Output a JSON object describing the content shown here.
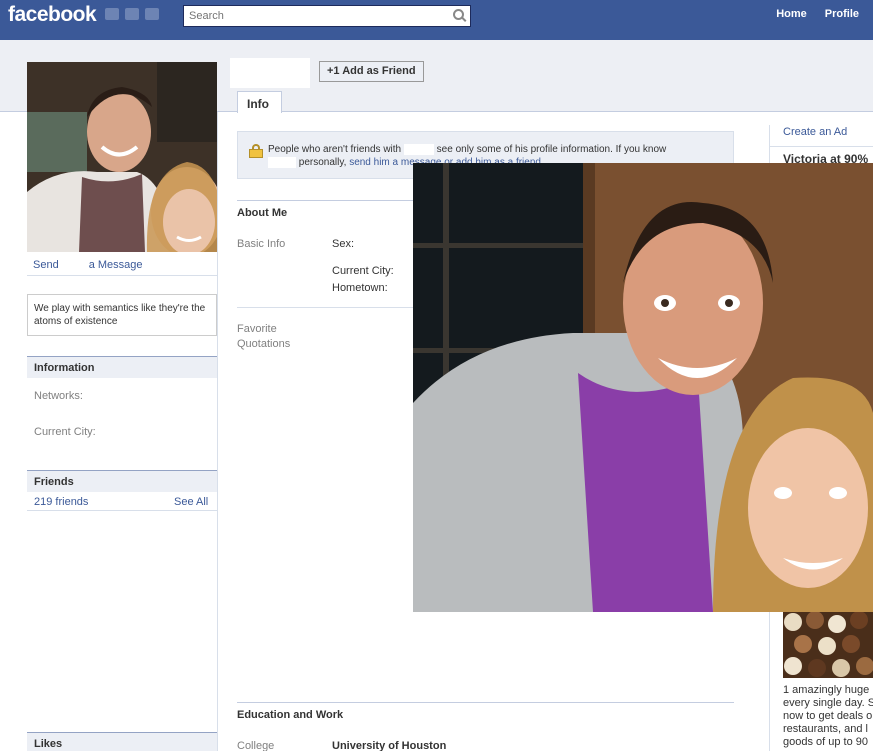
{
  "topbar": {
    "logo": "facebook",
    "search_placeholder": "Search",
    "links": [
      "Home",
      "Profile"
    ]
  },
  "header": {
    "add_friend_label": "+1 Add as Friend",
    "tab_label": "Info"
  },
  "left": {
    "send_message": [
      "Send",
      "a Message"
    ],
    "quote": "We play with semantics like they're the atoms of existence",
    "information": {
      "title": "Information",
      "networks_label": "Networks:",
      "city_label": "Current City:"
    },
    "friends": {
      "title": "Friends",
      "count": "219 friends",
      "see_all": "See All"
    },
    "likes_title": "Likes"
  },
  "main": {
    "notice": {
      "part1": "People who aren't friends with",
      "part2": "see only some of his profile information. If you know",
      "part3": "personally,",
      "link": "send him a message or add him as a friend."
    },
    "about_me": {
      "title": "About Me",
      "basic_info_label": "Basic Info",
      "sex_label": "Sex:",
      "current_city_label": "Current City:",
      "hometown_label": "Hometown:",
      "favorite_quotations_label": "Favorite Quotations"
    },
    "education": {
      "title": "Education and Work",
      "college_label": "College",
      "college_value": "University of Houston"
    }
  },
  "right": {
    "create_ad": "Create an Ad",
    "ad_title": "Victoria at 90%",
    "ad_text": [
      "1 amazingly huge",
      "every single day. S",
      "now to get deals o",
      "restaurants, and l",
      "goods of up to 90"
    ]
  }
}
